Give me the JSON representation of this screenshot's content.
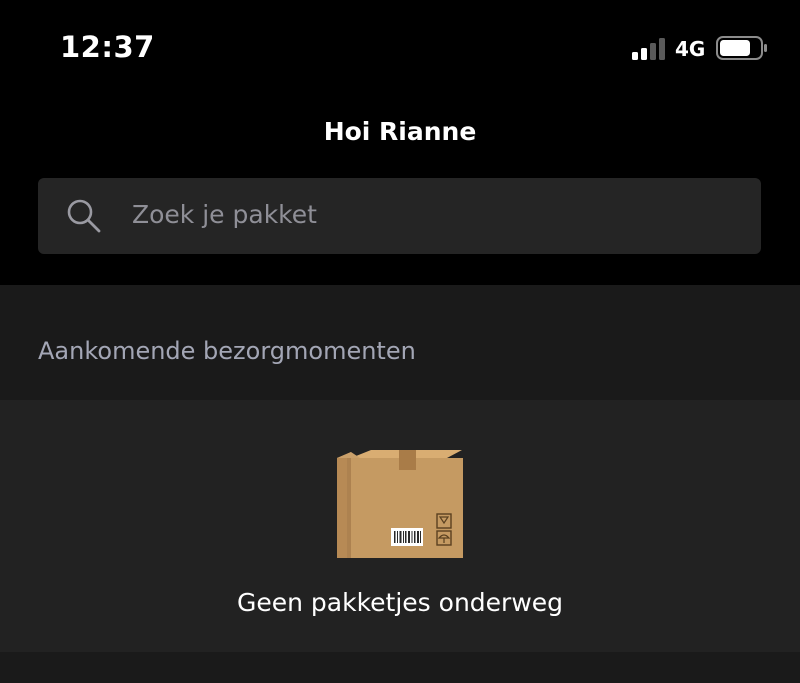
{
  "status_bar": {
    "time": "12:37",
    "network": "4G",
    "signal_bars": 2,
    "signal_bars_total": 4
  },
  "header": {
    "greeting": "Hoi Rianne"
  },
  "search": {
    "placeholder": "Zoek je pakket",
    "icon": "search-icon"
  },
  "upcoming": {
    "title": "Aankomende bezorgmomenten",
    "empty_icon": "package-box-icon",
    "empty_message": "Geen pakketjes onderweg"
  },
  "colors": {
    "background": "#000000",
    "search_bg": "#252525",
    "section_bg": "#1a1a1a",
    "card_bg": "#222222",
    "section_title": "#a3a6b5",
    "placeholder": "#8f8f97",
    "box": "#c59a62"
  }
}
